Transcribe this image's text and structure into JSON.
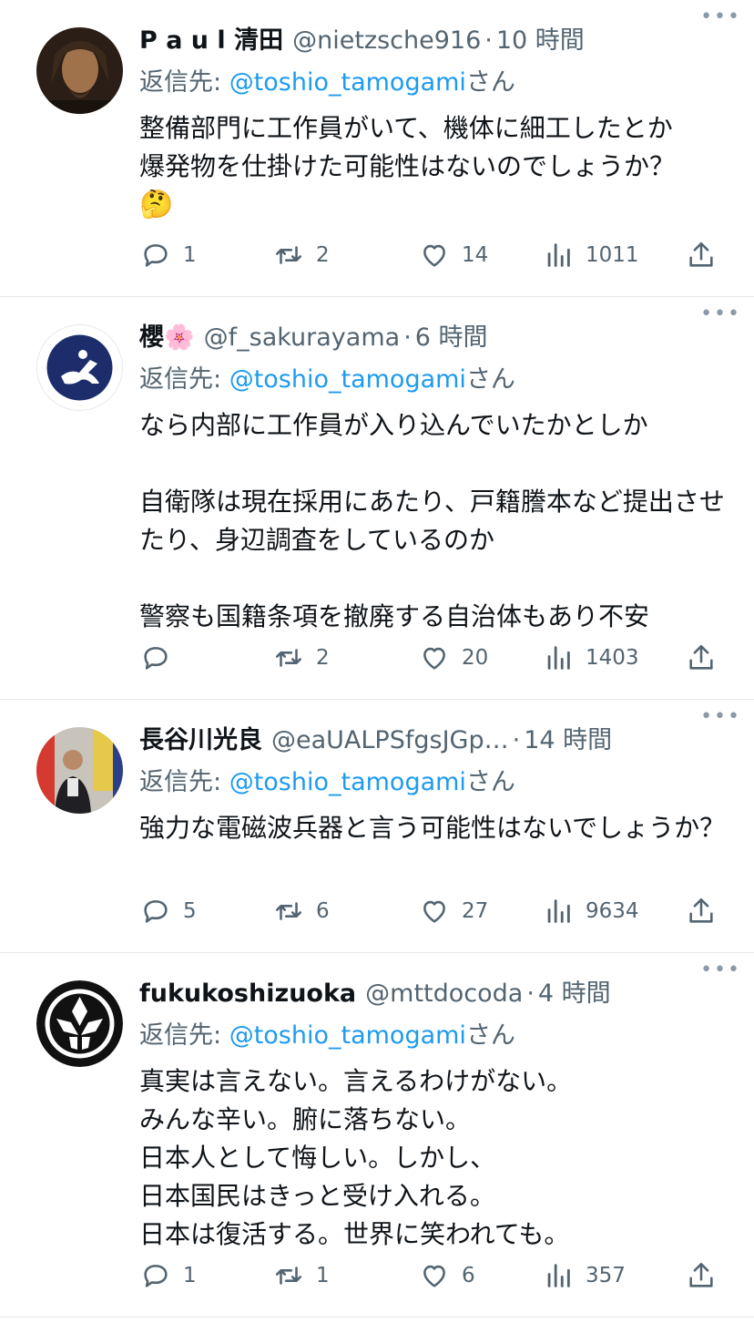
{
  "tweets": [
    {
      "display_name": "P a u l 清田",
      "handle": "@nietzsche916",
      "time": "10 時間",
      "reply_prefix": "返信先: ",
      "reply_mention": "@toshio_tamogami",
      "reply_suffix": "さん",
      "text": "整備部門に工作員がいて、機体に細工したとか\n爆発物を仕掛けた可能性はないのでしょうか？\n",
      "emoji": "🤔",
      "replies": "1",
      "retweets": "2",
      "likes": "14",
      "views": "1011"
    },
    {
      "display_name": "櫻🌸",
      "handle": "@f_sakurayama",
      "time": "6 時間",
      "reply_prefix": "返信先: ",
      "reply_mention": "@toshio_tamogami",
      "reply_suffix": "さん",
      "text": "なら内部に工作員が入り込んでいたかとしか\n\n自衛隊は現在採用にあたり、戸籍謄本など提出させたり、身辺調査をしているのか\n\n警察も国籍条項を撤廃する自治体もあり不安",
      "emoji": "",
      "replies": "",
      "retweets": "2",
      "likes": "20",
      "views": "1403"
    },
    {
      "display_name": "長谷川光良",
      "handle": "@eaUALPSfgsJGp…",
      "time": "14 時間",
      "reply_prefix": "返信先: ",
      "reply_mention": "@toshio_tamogami",
      "reply_suffix": "さん",
      "text": "強力な電磁波兵器と言う可能性はないでしょうか？",
      "emoji": "",
      "replies": "5",
      "retweets": "6",
      "likes": "27",
      "views": "9634"
    },
    {
      "display_name": "fukukoshizuoka",
      "handle": "@mttdocoda",
      "time": "4 時間",
      "reply_prefix": "返信先: ",
      "reply_mention": "@toshio_tamogami",
      "reply_suffix": "さん",
      "text": "真実は言えない。言えるわけがない。\nみんな辛い。腑に落ちない。\n日本人として悔しい。しかし、\n日本国民はきっと受け入れる。\n日本は復活する。世界に笑われても。",
      "emoji": "",
      "replies": "1",
      "retweets": "1",
      "likes": "6",
      "views": "357"
    }
  ],
  "icons": {
    "more": "more-horizontal-icon",
    "reply": "reply-bubble-icon",
    "retweet": "retweet-arrows-icon",
    "like": "heart-icon",
    "views": "analytics-bars-icon",
    "share": "share-upload-icon"
  },
  "colors": {
    "text": "#0f1419",
    "secondary": "#536471",
    "link": "#1d9bf0",
    "divider": "#e5e8eb"
  }
}
